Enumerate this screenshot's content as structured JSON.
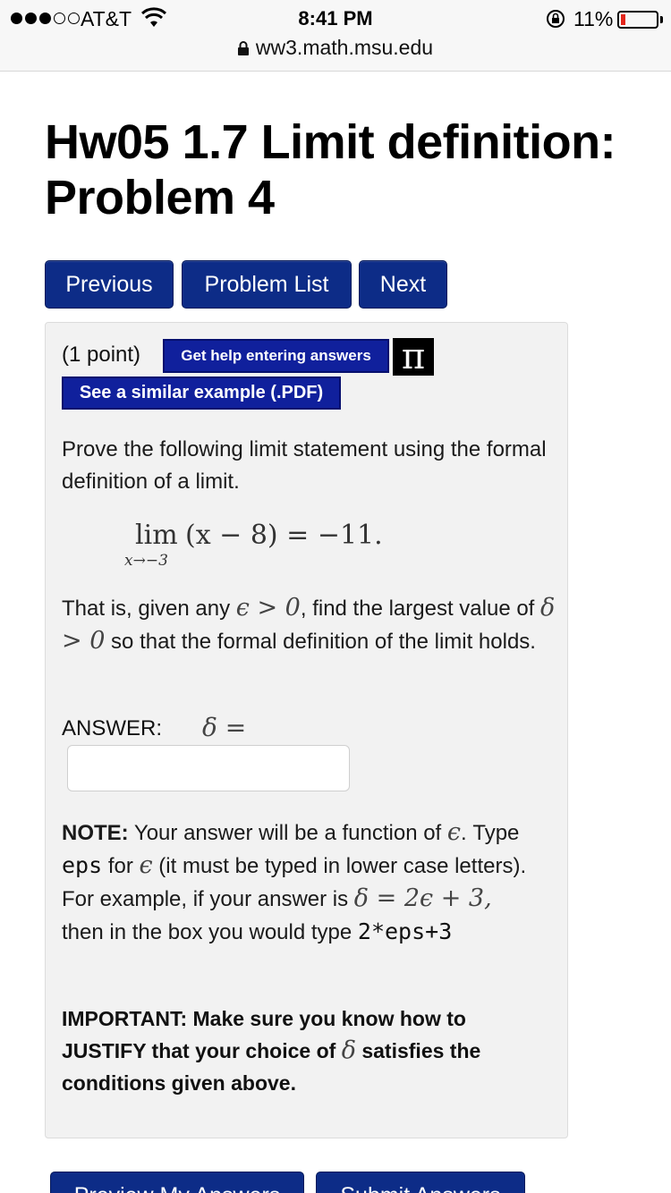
{
  "status_bar": {
    "carrier": "AT&T",
    "time": "8:41 PM",
    "battery_percent": "11%",
    "battery_level": 0.11,
    "url": "ww3.math.msu.edu"
  },
  "title": "Hw05 1.7 Limit definition:\nProblem 4",
  "nav": {
    "previous": "Previous",
    "problem_list": "Problem List",
    "next": "Next"
  },
  "problem": {
    "points": "(1 point)",
    "help_button": "Get help entering answers",
    "pi_icon": "π",
    "example_button": "See a similar example (.PDF)",
    "intro": "Prove the following limit statement using the formal definition of a limit.",
    "limit": {
      "lim": "lim",
      "sub": "x→−3",
      "expr": "(x − 8) = −11."
    },
    "that_is_1": "That is, given any ",
    "that_is_eps": "ϵ > 0",
    "that_is_2": ", find the largest value of ",
    "that_is_delta": "δ > 0",
    "that_is_3": " so that the formal definition of the limit holds.",
    "answer_label": "ANSWER:",
    "answer_math": "δ =",
    "answer_value": "",
    "note_bold": "NOTE:",
    "note_1": " Your answer will be a function of ",
    "note_eps": "ϵ",
    "note_2": ". Type ",
    "note_code": "eps",
    "note_3": " for ",
    "note_eps2": "ϵ",
    "note_4": " (it must be typed in lower case letters).",
    "example_1": "For example, if your answer is ",
    "example_math": "δ = 2ϵ + 3,",
    "example_2": "then in the box you would type ",
    "example_code": "2*eps+3",
    "important_1": "IMPORTANT: Make sure you know how to JUSTIFY that your choice of ",
    "important_delta": "δ",
    "important_2": " satisfies the conditions given above."
  },
  "bottom_buttons": {
    "preview": "Preview My Answers",
    "submit": "Submit Answers"
  }
}
